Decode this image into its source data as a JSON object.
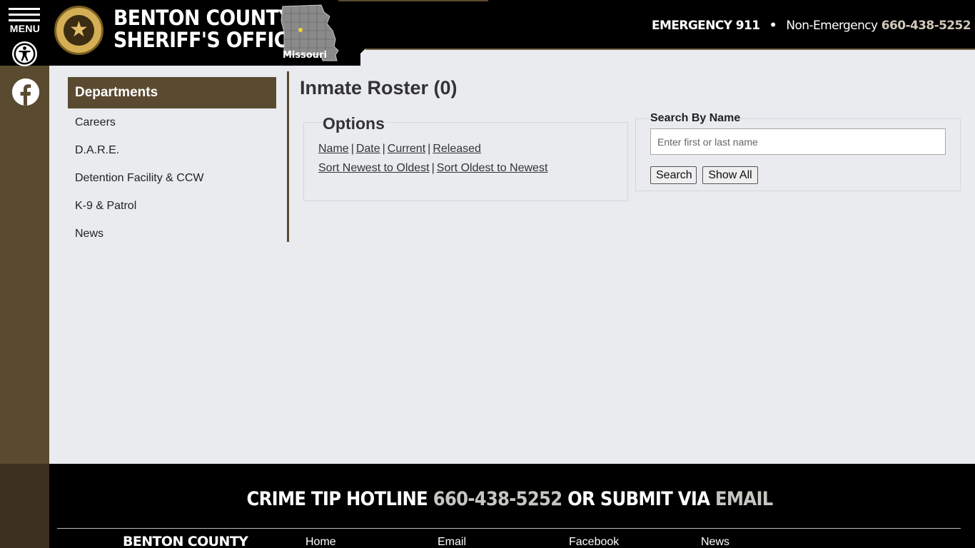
{
  "rail": {
    "menu_label": "MENU"
  },
  "header": {
    "title_line1": "BENTON COUNTY",
    "title_line2": "SHERIFF'S OFFICE",
    "state_label": "Missouri",
    "emergency": "EMERGENCY 911",
    "separator": "•",
    "non_emergency_label": "Non-Emergency",
    "non_emergency_phone": "660-438-5252"
  },
  "sidebar": {
    "heading": "Departments",
    "items": [
      {
        "label": "Careers"
      },
      {
        "label": "D.A.R.E."
      },
      {
        "label": "Detention Facility & CCW"
      },
      {
        "label": "K-9 & Patrol"
      },
      {
        "label": "News"
      }
    ]
  },
  "main": {
    "title": "Inmate Roster (0)",
    "options": {
      "legend": "Options",
      "filters": [
        "Name",
        "Date",
        "Current",
        "Released"
      ],
      "sorts": [
        "Sort Newest to Oldest",
        "Sort Oldest to Newest"
      ],
      "separator": "|"
    },
    "search": {
      "legend": "Search By Name",
      "placeholder": "Enter first or last name",
      "search_button": "Search",
      "show_all_button": "Show All"
    }
  },
  "footer": {
    "hotline_prefix": "CRIME TIP HOTLINE",
    "hotline_phone": "660-438-5252",
    "hotline_mid": "OR SUBMIT VIA",
    "hotline_email": "EMAIL",
    "brand": "BENTON COUNTY",
    "links": [
      "Home",
      "Email",
      "Facebook",
      "News"
    ]
  },
  "colors": {
    "brown": "#5a4a30",
    "black": "#000000",
    "page_bg": "#e9ebef",
    "accent_gray": "#c8c6c0"
  },
  "icons": {
    "menu": "hamburger-icon",
    "accessibility": "accessibility-icon",
    "social": "facebook-icon",
    "seal": "sheriff-badge-icon",
    "map": "missouri-map-icon"
  }
}
